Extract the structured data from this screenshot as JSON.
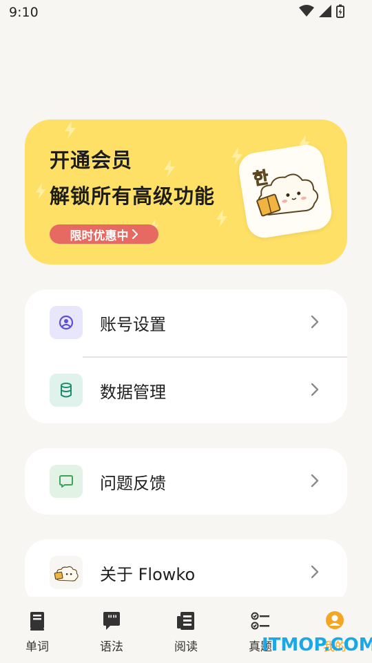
{
  "status_bar": {
    "time": "9:10"
  },
  "promo": {
    "line1": "开通会员",
    "line2": "解锁所有高级功能",
    "badge": "限时优惠中",
    "mascot_text": "한",
    "accent_color": "#ffe066",
    "badge_color": "#e76a62"
  },
  "menu_group1": [
    {
      "label": "账号设置",
      "icon": "user-circle-icon"
    },
    {
      "label": "数据管理",
      "icon": "database-icon"
    }
  ],
  "menu_group2": [
    {
      "label": "问题反馈",
      "icon": "chat-bubble-icon"
    }
  ],
  "menu_group3": [
    {
      "label": "关于 Flowko",
      "icon": "mascot-icon"
    }
  ],
  "bottom_nav": [
    {
      "label": "单词",
      "icon": "book-icon",
      "active": false
    },
    {
      "label": "语法",
      "icon": "quote-bubble-icon",
      "active": false
    },
    {
      "label": "阅读",
      "icon": "newspaper-icon",
      "active": false
    },
    {
      "label": "真题",
      "icon": "checklist-icon",
      "active": false
    },
    {
      "label": "我的",
      "icon": "profile-icon",
      "active": true
    }
  ],
  "watermark": "ITMOP.COM"
}
